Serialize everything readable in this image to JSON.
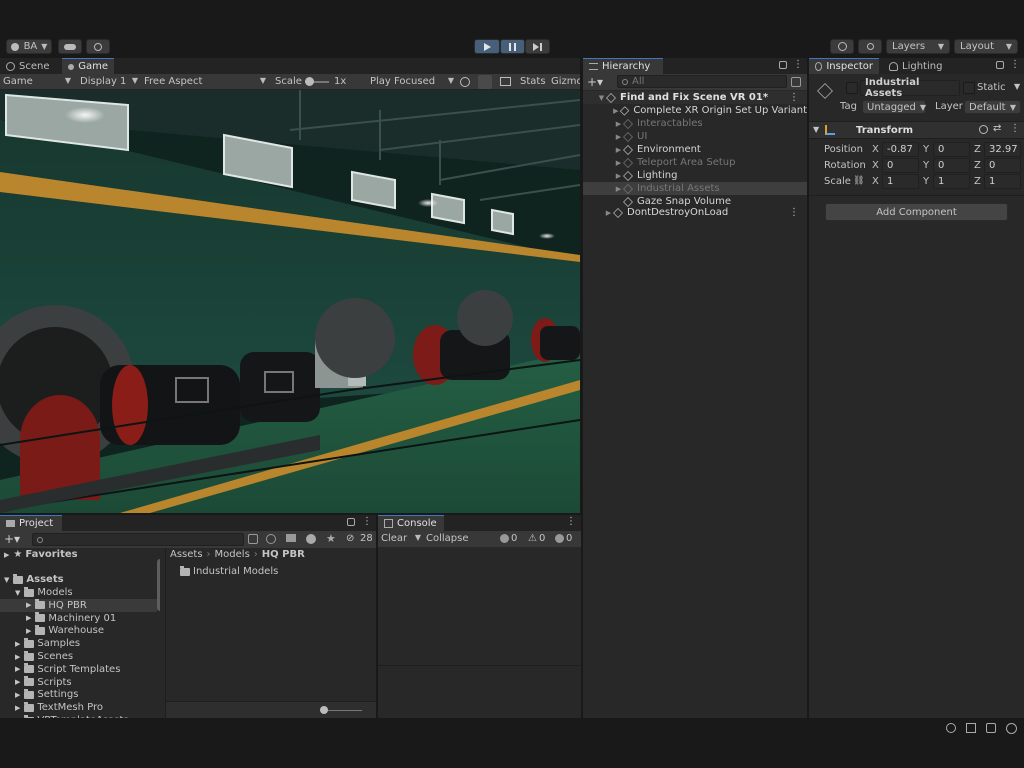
{
  "toolbar": {
    "account_label": "BA",
    "layers_label": "Layers",
    "layout_label": "Layout"
  },
  "scene_tabs": {
    "scene": "Scene",
    "game": "Game"
  },
  "game_bar": {
    "mode": "Game",
    "display": "Display 1",
    "aspect": "Free Aspect",
    "scale_label": "Scale",
    "scale_value": "1x",
    "play_mode": "Play Focused",
    "stats": "Stats",
    "gizmos": "Gizmo"
  },
  "hierarchy": {
    "tab": "Hierarchy",
    "search_placeholder": "All",
    "scene_name": "Find and Fix Scene VR 01*",
    "items": [
      {
        "label": "Complete XR Origin Set Up Variant",
        "dim": false,
        "has_arrow": true
      },
      {
        "label": "Interactables",
        "dim": true,
        "has_arrow": true
      },
      {
        "label": "UI",
        "dim": true,
        "has_arrow": true
      },
      {
        "label": "Environment",
        "dim": false,
        "has_arrow": true
      },
      {
        "label": "Teleport Area Setup",
        "dim": true,
        "has_arrow": true
      },
      {
        "label": "Lighting",
        "dim": false,
        "has_arrow": true
      },
      {
        "label": "Industrial Assets",
        "dim": true,
        "has_arrow": true,
        "selected": true
      },
      {
        "label": "Gaze Snap Volume",
        "dim": false,
        "has_arrow": false
      }
    ],
    "ddol": "DontDestroyOnLoad"
  },
  "inspector": {
    "tab": "Inspector",
    "tab2": "Lighting",
    "object_name": "Industrial Assets",
    "static_label": "Static",
    "tag_label": "Tag",
    "tag_value": "Untagged",
    "layer_label": "Layer",
    "layer_value": "Default",
    "transform_title": "Transform",
    "position_label": "Position",
    "rotation_label": "Rotation",
    "scale_label": "Scale",
    "position": {
      "x": "-0.87",
      "y": "0",
      "z": "32.97"
    },
    "rotation": {
      "x": "0",
      "y": "0",
      "z": "0"
    },
    "scale": {
      "x": "1",
      "y": "1",
      "z": "1"
    },
    "add_component": "Add Component"
  },
  "project": {
    "tab": "Project",
    "hidden_count": "28",
    "favorites": "Favorites",
    "assets": "Assets",
    "tree": [
      {
        "label": "Models",
        "depth": 1,
        "open": true
      },
      {
        "label": "HQ PBR",
        "depth": 2,
        "selected": true
      },
      {
        "label": "Machinery 01",
        "depth": 2
      },
      {
        "label": "Warehouse",
        "depth": 2
      },
      {
        "label": "Samples",
        "depth": 1
      },
      {
        "label": "Scenes",
        "depth": 1
      },
      {
        "label": "Script Templates",
        "depth": 1
      },
      {
        "label": "Scripts",
        "depth": 1
      },
      {
        "label": "Settings",
        "depth": 1
      },
      {
        "label": "TextMesh Pro",
        "depth": 1
      },
      {
        "label": "VRTemplateAssets",
        "depth": 1
      }
    ],
    "breadcrumb": [
      "Assets",
      "Models",
      "HQ PBR"
    ],
    "content": [
      "Industrial Models"
    ]
  },
  "console": {
    "tab": "Console",
    "clear": "Clear",
    "collapse": "Collapse",
    "log_count": "0",
    "warn_count": "0",
    "error_count": "0"
  },
  "colors": {
    "accent": "#3a79bb",
    "wall": "#1f4a40",
    "floor": "#2d6a4a",
    "stripe": "#c88a2a"
  }
}
